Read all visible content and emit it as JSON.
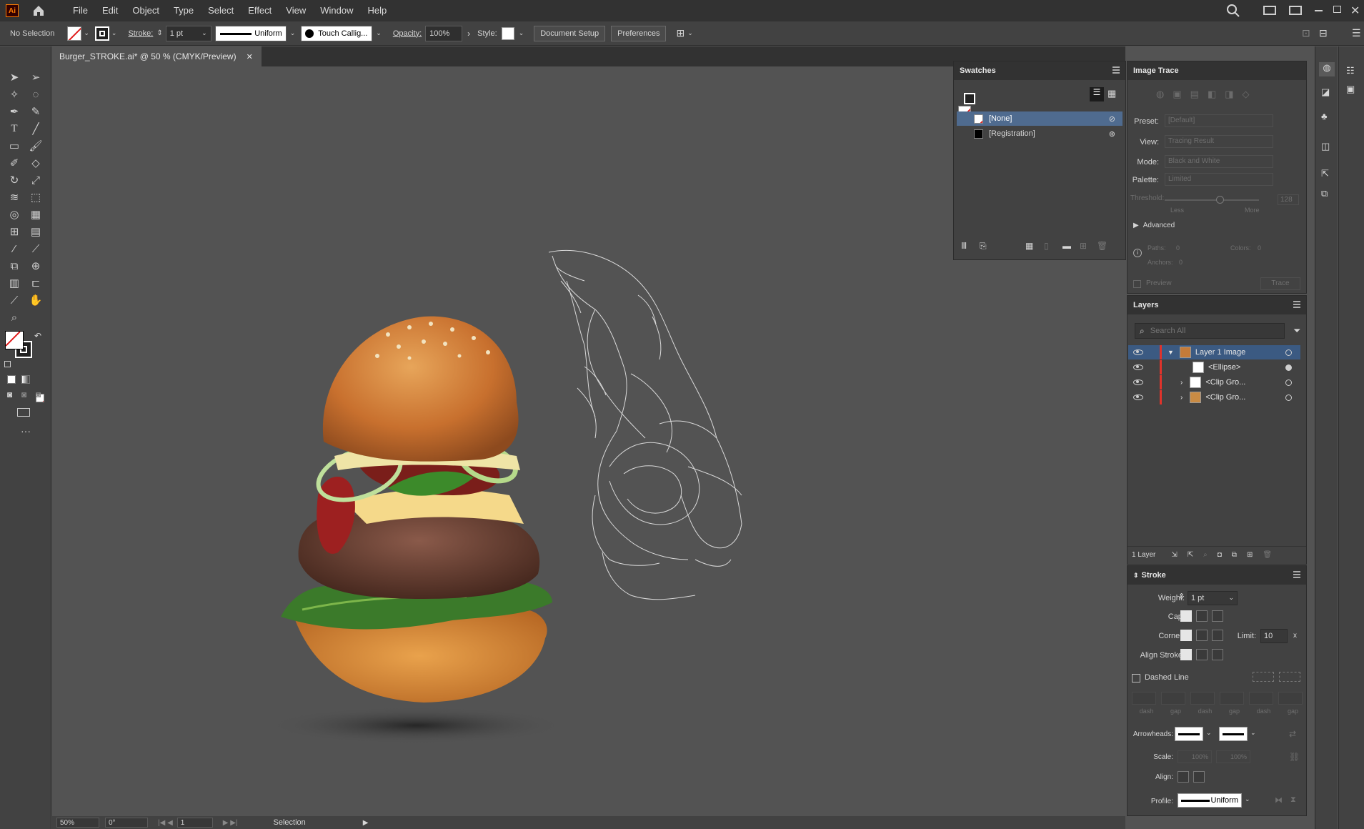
{
  "app": {
    "logo": "Ai",
    "accent": "#ff7c00"
  },
  "menubar": {
    "items": [
      "File",
      "Edit",
      "Object",
      "Type",
      "Select",
      "Effect",
      "View",
      "Window",
      "Help"
    ]
  },
  "control": {
    "selection": "No Selection",
    "stroke_label": "Stroke:",
    "stroke_weight": "1 pt",
    "stroke_style": "Uniform",
    "brush": "Touch Callig...",
    "opacity_label": "Opacity:",
    "opacity_value": "100%",
    "style_label": "Style:",
    "document_setup": "Document Setup",
    "preferences": "Preferences"
  },
  "document": {
    "tab_title": "Burger_STROKE.ai* @ 50 % (CMYK/Preview)"
  },
  "status": {
    "zoom": "50%",
    "rotation": "0°",
    "artboard": "1",
    "tool": "Selection"
  },
  "swatches": {
    "title": "Swatches",
    "items": [
      {
        "name": "[None]",
        "color": "none",
        "selected": true
      },
      {
        "name": "[Registration]",
        "color": "#000000",
        "selected": false
      }
    ]
  },
  "image_trace": {
    "title": "Image Trace",
    "preset_label": "Preset:",
    "preset": "[Default]",
    "view_label": "View:",
    "view": "Tracing Result",
    "mode_label": "Mode:",
    "mode": "Black and White",
    "palette_label": "Palette:",
    "palette": "Limited",
    "threshold_label": "Threshold:",
    "threshold": "128",
    "less": "Less",
    "more": "More",
    "advanced": "Advanced",
    "paths_label": "Paths:",
    "paths": "0",
    "colors_label": "Colors:",
    "colors": "0",
    "anchors_label": "Anchors:",
    "anchors": "0",
    "preview": "Preview",
    "trace": "Trace"
  },
  "layers": {
    "title": "Layers",
    "search_placeholder": "Search All",
    "rows": [
      {
        "name": "Layer 1 Image",
        "level": 0,
        "expanded": true,
        "selected": true
      },
      {
        "name": "<Ellipse>",
        "level": 1,
        "expanded": false,
        "selected": false
      },
      {
        "name": "<Clip Gro...",
        "level": 1,
        "expanded": false,
        "selected": false
      },
      {
        "name": "<Clip Gro...",
        "level": 1,
        "expanded": false,
        "selected": false
      }
    ],
    "count": "1 Layer",
    "layer_color": "#e0332b"
  },
  "stroke_panel": {
    "title": "Stroke",
    "weight_label": "Weight:",
    "weight": "1 pt",
    "cap_label": "Cap:",
    "corner_label": "Corner:",
    "limit_label": "Limit:",
    "limit": "10",
    "align_label": "Align Stroke:",
    "dashed_label": "Dashed Line",
    "dash_labels": [
      "dash",
      "gap",
      "dash",
      "gap",
      "dash",
      "gap"
    ],
    "arrowheads_label": "Arrowheads:",
    "scale_label": "Scale:",
    "scale_start": "100%",
    "scale_end": "100%",
    "align_arrow_label": "Align:",
    "profile_label": "Profile:",
    "profile": "Uniform"
  }
}
